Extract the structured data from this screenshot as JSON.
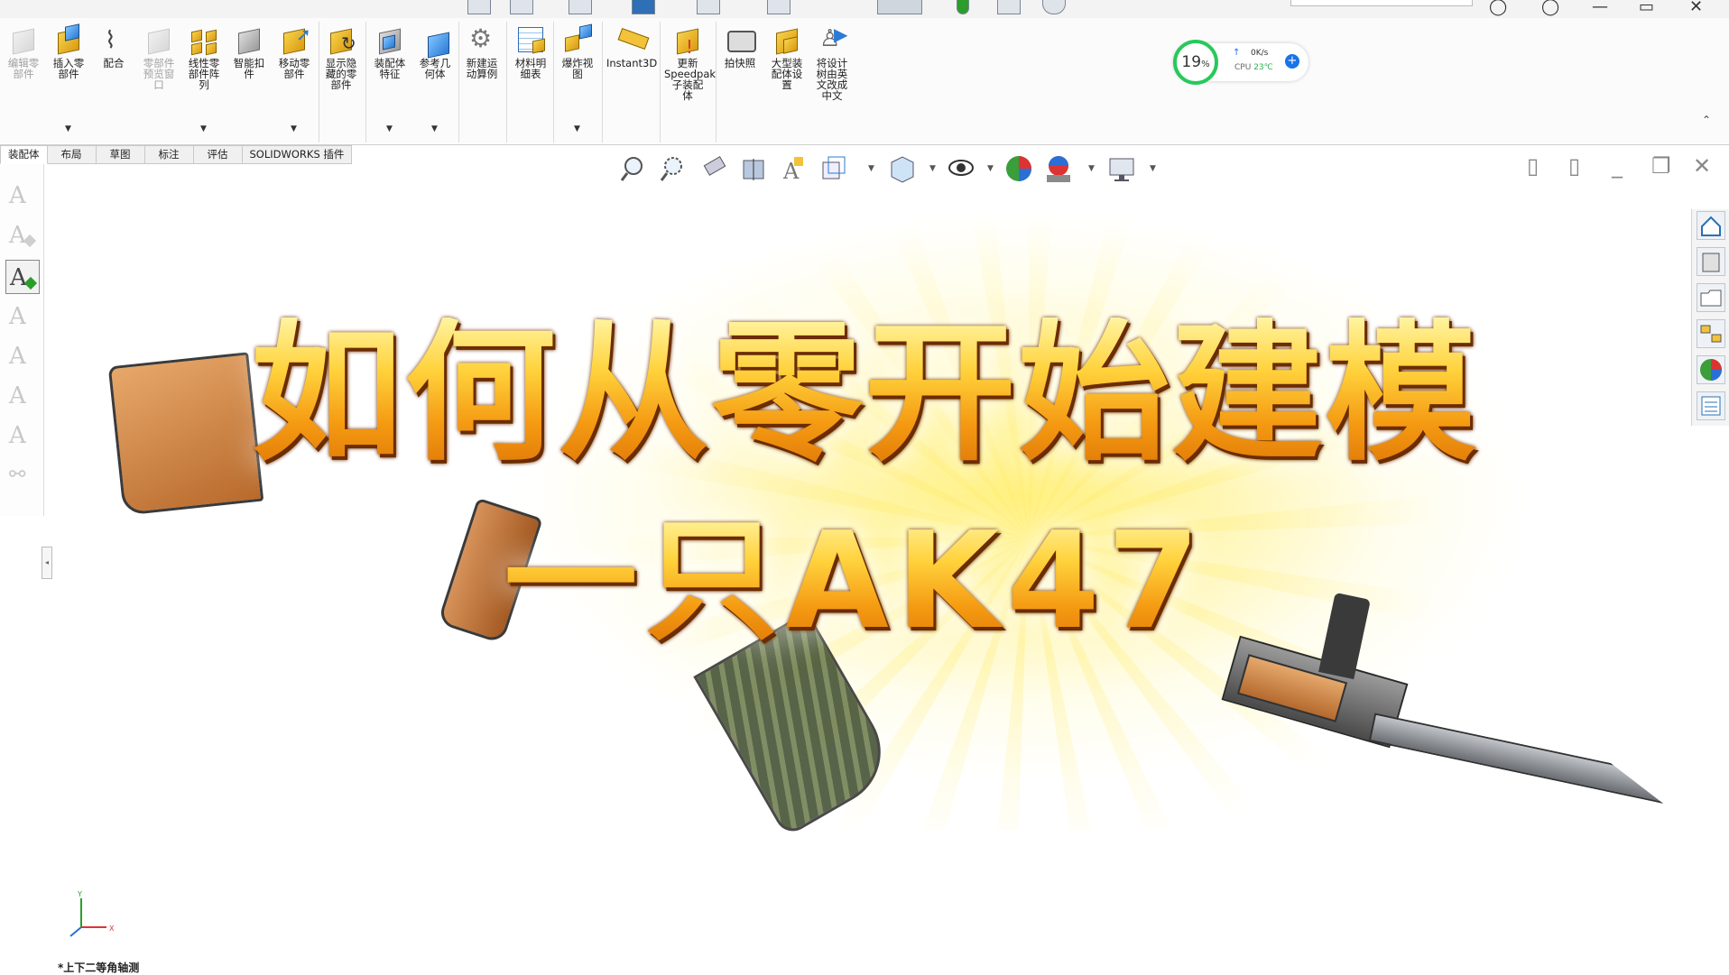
{
  "ribbon": {
    "buttons": [
      {
        "label": "编辑零\n部件",
        "disabled": true
      },
      {
        "label": "插入零\n部件",
        "disabled": false
      },
      {
        "label": "配合",
        "disabled": false
      },
      {
        "label": "零部件\n预览窗\n口",
        "disabled": true
      },
      {
        "label": "线性零\n部件阵\n列",
        "disabled": false
      },
      {
        "label": "智能扣\n件",
        "disabled": false
      },
      {
        "label": "移动零\n部件",
        "disabled": false
      },
      {
        "label": "显示隐\n藏的零\n部件",
        "disabled": false
      },
      {
        "label": "装配体\n特征",
        "disabled": false
      },
      {
        "label": "参考几\n何体",
        "disabled": false
      },
      {
        "label": "新建运\n动算例",
        "disabled": false
      },
      {
        "label": "材料明\n细表",
        "disabled": false
      },
      {
        "label": "爆炸视\n图",
        "disabled": false
      },
      {
        "label": "Instant3D",
        "disabled": false
      },
      {
        "label": "更新\nSpeedpak\n子装配\n体",
        "disabled": false
      },
      {
        "label": "拍快照",
        "disabled": false
      },
      {
        "label": "大型装\n配体设\n置",
        "disabled": false
      },
      {
        "label": "将设计\n树由英\n文改成\n中文",
        "disabled": false
      }
    ]
  },
  "perf_widget": {
    "cpu_percent": "19",
    "percent_sign": "%",
    "net_speed": "0K/s",
    "cpu_label": "CPU",
    "cpu_temp": "23℃"
  },
  "tabs": [
    {
      "label": "装配体",
      "active": true
    },
    {
      "label": "布局",
      "active": false
    },
    {
      "label": "草图",
      "active": false
    },
    {
      "label": "标注",
      "active": false
    },
    {
      "label": "评估",
      "active": false
    },
    {
      "label": "SOLIDWORKS 插件",
      "active": false
    }
  ],
  "overlay": {
    "line1": "如何从零开始建模",
    "line2": "一只AK47"
  },
  "view": {
    "name": "*上下二等角轴测",
    "triad_axes": {
      "x": "X",
      "y": "Y"
    }
  },
  "colors": {
    "accent_green": "#27c95a",
    "title_orange": "#f59a12",
    "glow_yellow": "#fff078"
  }
}
